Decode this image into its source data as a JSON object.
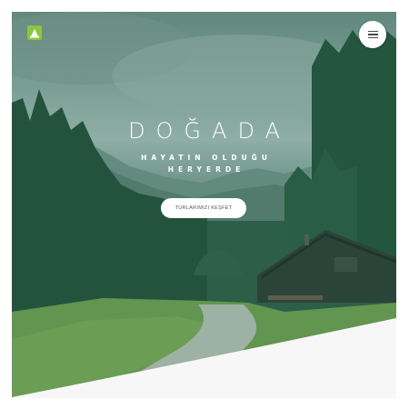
{
  "brand": {
    "logo_icon": "leaf-logo-icon",
    "accent": "#8cc63f"
  },
  "header": {
    "menu_icon": "hamburger-menu-icon"
  },
  "hero": {
    "title": "DOĞADA",
    "subtitle_line1": "HAYATIN OLDUĞU",
    "subtitle_line2": "HERYERDE",
    "cta_label": "TURLARIMIZI KEŞFET"
  },
  "colors": {
    "overlay": "#2f6f5c",
    "button_bg": "#ffffff",
    "page_bg": "#ffffff"
  }
}
